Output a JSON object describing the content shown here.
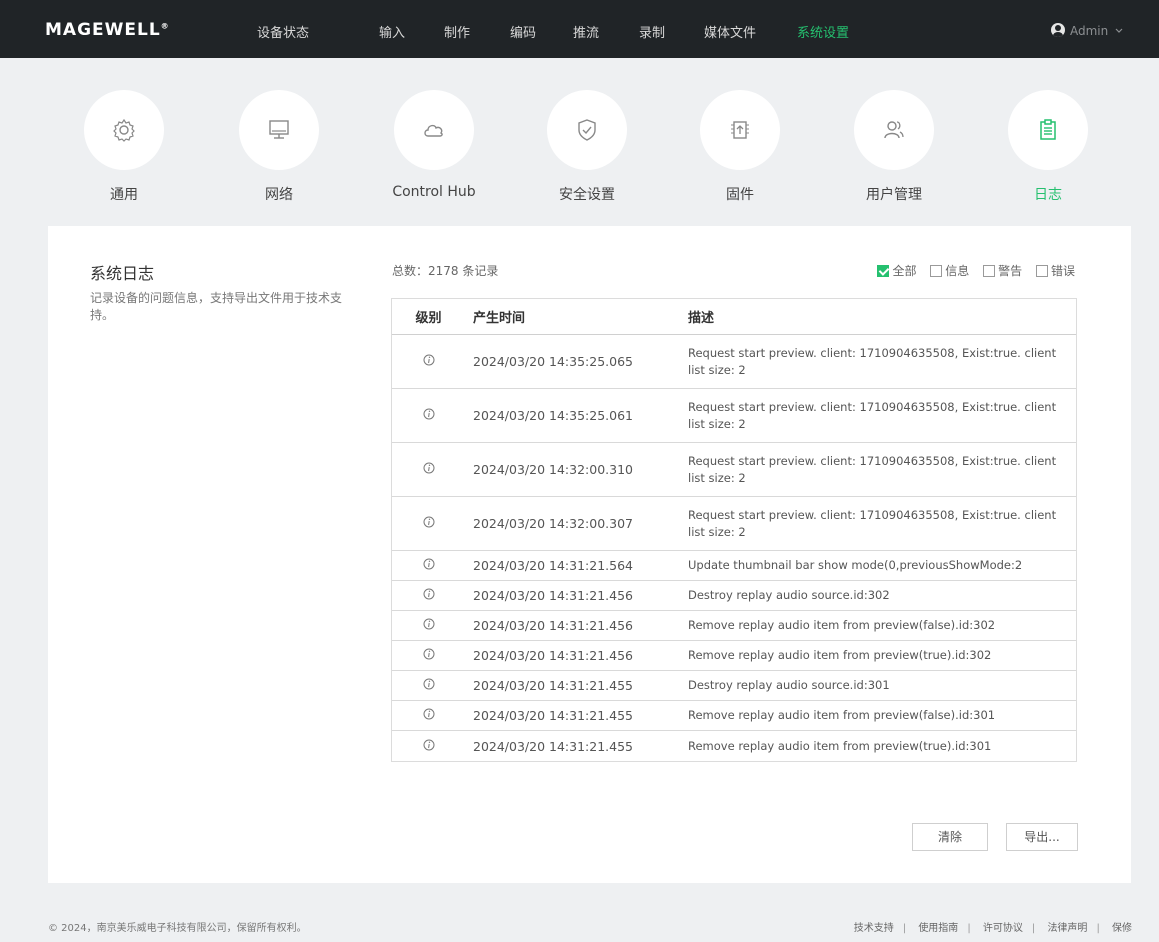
{
  "brand": {
    "logo": "MAGEWELL",
    "mark": "®"
  },
  "nav": {
    "items": [
      {
        "label": "设备状态"
      },
      {
        "label": "输入"
      },
      {
        "label": "制作"
      },
      {
        "label": "编码"
      },
      {
        "label": "推流"
      },
      {
        "label": "录制"
      },
      {
        "label": "媒体文件"
      },
      {
        "label": "系统设置"
      }
    ],
    "active_index": 7,
    "user": "Admin"
  },
  "categories": [
    {
      "label": "通用",
      "icon": "gear-icon"
    },
    {
      "label": "网络",
      "icon": "monitor-icon"
    },
    {
      "label": "Control Hub",
      "icon": "cloud-icon"
    },
    {
      "label": "安全设置",
      "icon": "shield-icon"
    },
    {
      "label": "固件",
      "icon": "firmware-icon"
    },
    {
      "label": "用户管理",
      "icon": "users-icon"
    },
    {
      "label": "日志",
      "icon": "clipboard-icon"
    }
  ],
  "active_category": 6,
  "section": {
    "title": "系统日志",
    "description": "记录设备的问题信息，支持导出文件用于技术支持。"
  },
  "log": {
    "total_text": "总数：2178 条记录",
    "filters": [
      {
        "label": "全部",
        "checked": true
      },
      {
        "label": "信息",
        "checked": false
      },
      {
        "label": "警告",
        "checked": false
      },
      {
        "label": "错误",
        "checked": false
      }
    ],
    "columns": {
      "level": "级别",
      "time": "产生时间",
      "desc": "描述"
    },
    "rows": [
      {
        "level": "info",
        "time": "2024/03/20 14:35:25.065",
        "desc": "Request start preview. client: 1710904635508, Exist:true. client list size: 2"
      },
      {
        "level": "info",
        "time": "2024/03/20 14:35:25.061",
        "desc": "Request start preview. client: 1710904635508, Exist:true. client list size: 2"
      },
      {
        "level": "info",
        "time": "2024/03/20 14:32:00.310",
        "desc": "Request start preview. client: 1710904635508, Exist:true. client list size: 2"
      },
      {
        "level": "info",
        "time": "2024/03/20 14:32:00.307",
        "desc": "Request start preview. client: 1710904635508, Exist:true. client list size: 2"
      },
      {
        "level": "info",
        "time": "2024/03/20 14:31:21.564",
        "desc": "Update thumbnail bar show mode(0,previousShowMode:2"
      },
      {
        "level": "info",
        "time": "2024/03/20 14:31:21.456",
        "desc": "Destroy replay audio source.id:302"
      },
      {
        "level": "info",
        "time": "2024/03/20 14:31:21.456",
        "desc": "Remove replay audio item from preview(false).id:302"
      },
      {
        "level": "info",
        "time": "2024/03/20 14:31:21.456",
        "desc": "Remove replay audio item from preview(true).id:302"
      },
      {
        "level": "info",
        "time": "2024/03/20 14:31:21.455",
        "desc": "Destroy replay audio source.id:301"
      },
      {
        "level": "info",
        "time": "2024/03/20 14:31:21.455",
        "desc": "Remove replay audio item from preview(false).id:301"
      },
      {
        "level": "info",
        "time": "2024/03/20 14:31:21.455",
        "desc": "Remove replay audio item from preview(true).id:301"
      }
    ],
    "buttons": {
      "clear": "清除",
      "export": "导出..."
    }
  },
  "footer": {
    "copyright": "© 2024，南京美乐威电子科技有限公司，保留所有权利。",
    "links": [
      "技术支持",
      "使用指南",
      "许可协议",
      "法律声明",
      "保修"
    ]
  },
  "colors": {
    "accent": "#25c06f",
    "topbar": "#202427"
  }
}
